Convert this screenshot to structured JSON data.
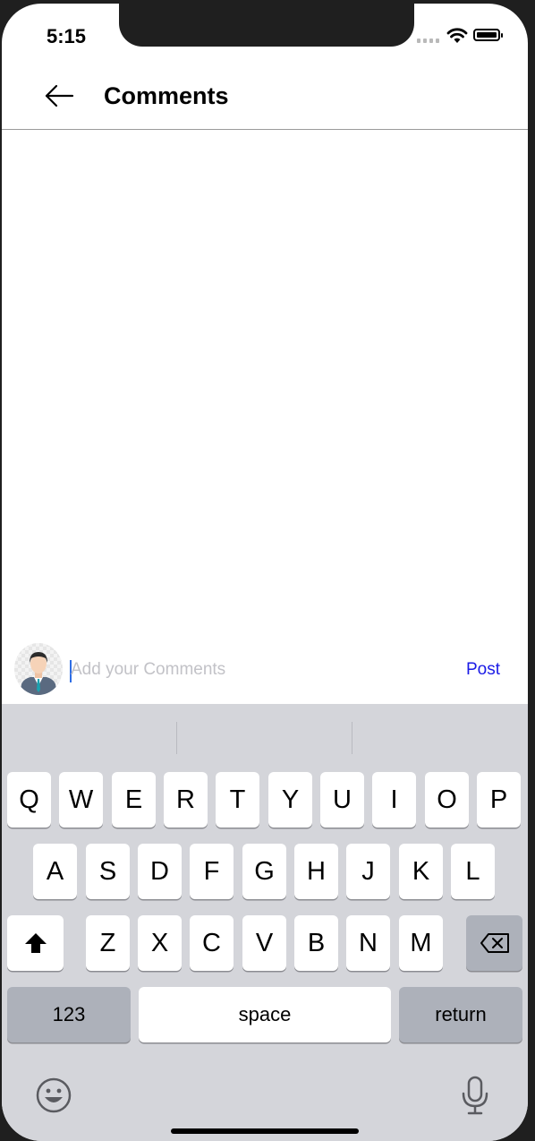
{
  "status_bar": {
    "time": "5:15"
  },
  "header": {
    "title": "Comments",
    "back_icon": "arrow-left-icon"
  },
  "comment_bar": {
    "placeholder": "Add your Comments",
    "value": "",
    "post_label": "Post",
    "post_color": "#1a1ae6",
    "avatar_icon": "user-avatar-icon"
  },
  "keyboard": {
    "row1": [
      "Q",
      "W",
      "E",
      "R",
      "T",
      "Y",
      "U",
      "I",
      "O",
      "P"
    ],
    "row2": [
      "A",
      "S",
      "D",
      "F",
      "G",
      "H",
      "J",
      "K",
      "L"
    ],
    "row3": [
      "Z",
      "X",
      "C",
      "V",
      "B",
      "N",
      "M"
    ],
    "numbers_label": "123",
    "space_label": "space",
    "return_label": "return",
    "shift_icon": "shift-icon",
    "delete_icon": "backspace-icon",
    "emoji_icon": "emoji-icon",
    "mic_icon": "microphone-icon"
  }
}
